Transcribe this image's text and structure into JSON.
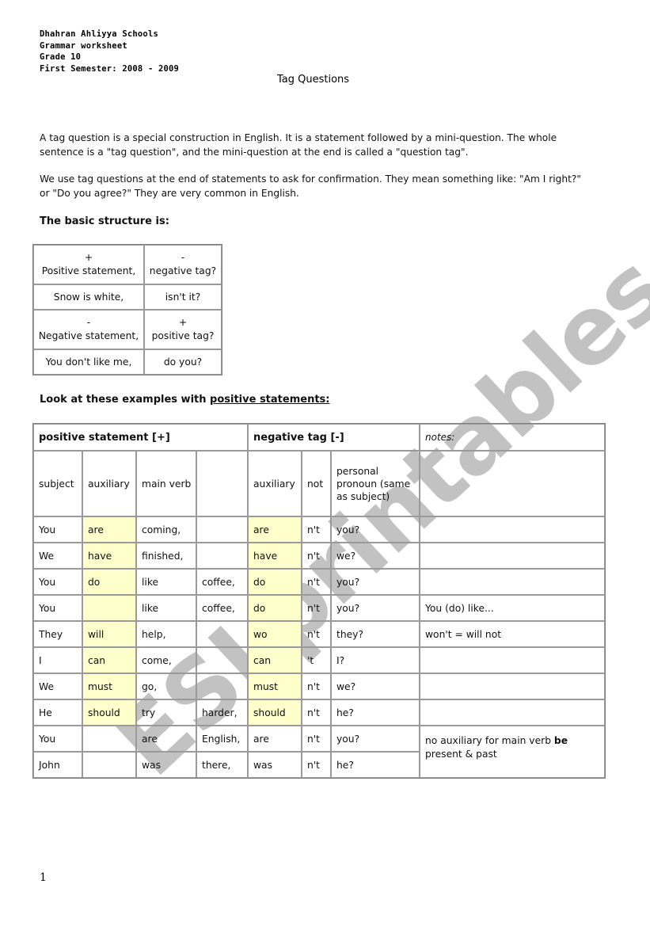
{
  "header": {
    "lines": [
      "Dhahran Ahliyya Schools",
      "Grammar worksheet",
      "Grade 10",
      "First Semester: 2008 - 2009"
    ],
    "title": "Tag Questions"
  },
  "intro": {
    "paragraph_1": "A tag question is a special construction in English. It is a statement followed by a mini-question. The whole sentence is a \"tag question\", and the mini-question at the end is called a \"question tag\".",
    "paragraph_2": "We use tag questions at the end of statements to ask for confirmation. They mean something like: \"Am I right?\" or \"Do you agree?\" They are very common in English."
  },
  "structure": {
    "heading": "The basic structure is:",
    "rows": [
      {
        "left_sign": "+",
        "left": "Positive statement,",
        "right_sign": "-",
        "right": "negative tag?"
      },
      {
        "left": "Snow is white,",
        "right": "isn't it?"
      },
      {
        "left_sign": "-",
        "left": "Negative statement,",
        "right_sign": "+",
        "right": "positive tag?"
      },
      {
        "left": "You don't like me,",
        "right": "do you?"
      }
    ]
  },
  "examples": {
    "heading_prefix": "Look at these examples with ",
    "heading_underlined": "positive statements:",
    "group_headers": {
      "positive": "positive statement [+]",
      "negative": "negative tag [-]",
      "notes": "notes:"
    },
    "sub_headers": {
      "subject": "subject",
      "auxiliary": "auxiliary",
      "main_verb": "main verb",
      "extra": "",
      "tag_auxiliary": "auxiliary",
      "not": "not",
      "pronoun": "personal pronoun (same as subject)"
    },
    "rows": [
      {
        "subject": "You",
        "aux": "are",
        "verb": "coming,",
        "extra": "",
        "tag_aux": "are",
        "not": "n't",
        "pronoun": "you?",
        "note": ""
      },
      {
        "subject": "We",
        "aux": "have",
        "verb": "finished,",
        "extra": "",
        "tag_aux": "have",
        "not": "n't",
        "pronoun": "we?",
        "note": ""
      },
      {
        "subject": "You",
        "aux": "do",
        "verb": "like",
        "extra": "coffee,",
        "tag_aux": "do",
        "not": "n't",
        "pronoun": "you?",
        "note": ""
      },
      {
        "subject": "You",
        "aux": "",
        "verb": "like",
        "extra": "coffee,",
        "tag_aux": "do",
        "not": "n't",
        "pronoun": "you?",
        "note": "You (do) like..."
      },
      {
        "subject": "They",
        "aux": "will",
        "verb": "help,",
        "extra": "",
        "tag_aux": "wo",
        "not": "n't",
        "pronoun": "they?",
        "note": "won't = will not"
      },
      {
        "subject": "I",
        "aux": "can",
        "verb": "come,",
        "extra": "",
        "tag_aux": "can",
        "not": "'t",
        "pronoun": "I?",
        "note": ""
      },
      {
        "subject": "We",
        "aux": "must",
        "verb": "go,",
        "extra": "",
        "tag_aux": "must",
        "not": "n't",
        "pronoun": "we?",
        "note": ""
      },
      {
        "subject": "He",
        "aux": "should",
        "verb": "try",
        "extra": "harder,",
        "tag_aux": "should",
        "not": "n't",
        "pronoun": "he?",
        "note": ""
      },
      {
        "subject": "You",
        "aux": "",
        "verb": "are",
        "extra": "English,",
        "tag_aux": "are",
        "not": "n't",
        "pronoun": "you?"
      },
      {
        "subject": "John",
        "aux": "",
        "verb": "was",
        "extra": "there,",
        "tag_aux": "was",
        "not": "n't",
        "pronoun": "he?"
      }
    ],
    "merged_note": {
      "prefix": "no auxiliary for main verb ",
      "bold": "be",
      "suffix": "present & past"
    },
    "highlight_color": "#ffffcc"
  },
  "footer": {
    "page_number": "1"
  },
  "watermark": "ESLprintables.com"
}
